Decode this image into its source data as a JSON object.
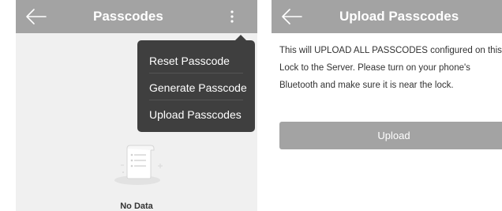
{
  "left_screen": {
    "title": "Passcodes",
    "back_icon": "arrow-left-icon",
    "more_icon": "more-vertical-icon",
    "menu": {
      "items": [
        {
          "label": "Reset Passcode"
        },
        {
          "label": "Generate Passcode"
        },
        {
          "label": "Upload Passcodes"
        }
      ]
    },
    "empty_state": {
      "icon": "empty-document-icon",
      "text": "No Data"
    }
  },
  "right_screen": {
    "title": "Upload Passcodes",
    "back_icon": "arrow-left-icon",
    "description": "This will UPLOAD ALL PASSCODES configured on this Lock to the Server. Please turn on your phone's Bluetooth and make sure it is near the lock.",
    "upload_button_label": "Upload"
  },
  "colors": {
    "header_bg": "#a3a3a3",
    "menu_bg": "#3f3f3f",
    "left_bg": "#f0f0f0",
    "button_bg": "#a3a3a3",
    "text_white": "#ffffff",
    "text_dark": "#333333"
  }
}
